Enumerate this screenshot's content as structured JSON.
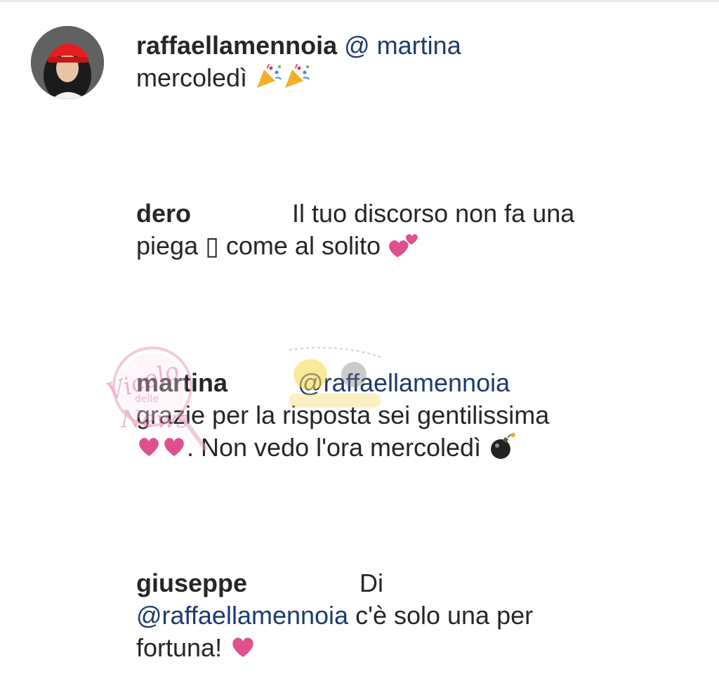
{
  "comments": [
    {
      "username": "raffaellamennoia",
      "mention": "@  martina",
      "text": "mercoledì",
      "emojis": [
        "party-popper-icon",
        "party-popper-icon"
      ]
    },
    {
      "username": "dero",
      "text_line1": "Il tuo discorso non fa una",
      "text_line2": "piega ▯ come al solito",
      "emojis": [
        "two-hearts-icon"
      ]
    },
    {
      "username": "martina",
      "mention": "@raffaellamennoia",
      "text_line2": "grazie per la risposta sei gentilissima",
      "text_line3": ". Non vedo l'ora mercoledì",
      "emojis": [
        "heart-icon",
        "heart-icon",
        "bomb-icon"
      ]
    },
    {
      "username": "giuseppe",
      "text_line1": "Di",
      "mention": "@raffaellamennoia",
      "text_line2": " c'è solo una per",
      "text_line3": "fortuna! ",
      "emojis": [
        "heart-icon"
      ]
    }
  ],
  "watermark": {
    "line1": "Vicolo",
    "line2": "delle",
    "line3": "News"
  },
  "colors": {
    "username": "#262626",
    "text": "#262626",
    "mention": "#1e3a6e",
    "heart": "#e0508f"
  }
}
